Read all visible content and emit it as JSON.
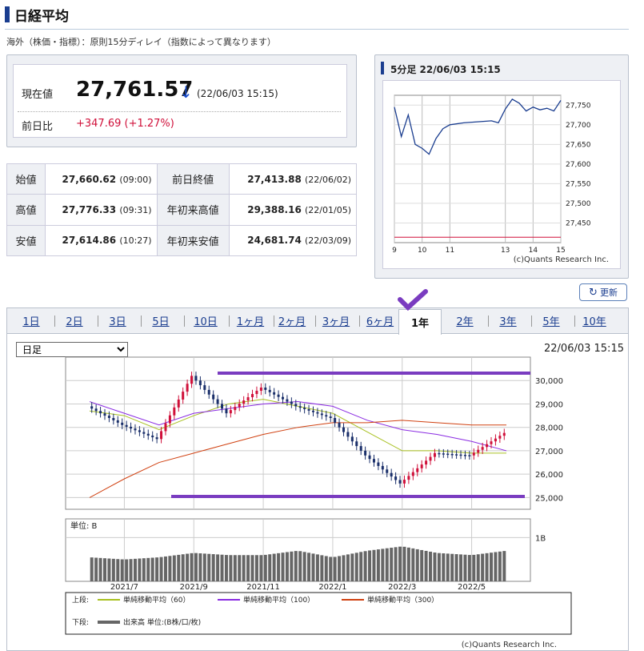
{
  "header": {
    "title": "日経平均",
    "note": "海外（株価・指標）：原則15分ディレイ（指数によって異なります）"
  },
  "quote": {
    "price_label": "現在値",
    "price": "27,761.57",
    "arrow": "↓",
    "time": "(22/06/03 15:15)",
    "change_label": "前日比",
    "change": "+347.69 (+1.27%)"
  },
  "ohlc": [
    {
      "l1": "始値",
      "v1": "27,660.62",
      "t1": "(09:00)",
      "l2": "前日終値",
      "v2": "27,413.88",
      "t2": "(22/06/02)"
    },
    {
      "l1": "高値",
      "v1": "27,776.33",
      "t1": "(09:31)",
      "l2": "年初来高値",
      "v2": "29,388.16",
      "t2": "(22/01/05)"
    },
    {
      "l1": "安値",
      "v1": "27,614.86",
      "t1": "(10:27)",
      "l2": "年初来安値",
      "v2": "24,681.74",
      "t2": "(22/03/09)"
    }
  ],
  "mini": {
    "title": "5分足 22/06/03 15:15",
    "credit": "(c)Quants Research Inc.",
    "refresh": "更新"
  },
  "tabs": [
    "1日",
    "2日",
    "3日",
    "5日",
    "10日",
    "1ヶ月",
    "2ヶ月",
    "3ヶ月",
    "6ヶ月",
    "1年",
    "2年",
    "3年",
    "5年",
    "10年"
  ],
  "active_tab": "1年",
  "select_value": "日足",
  "chart_time": "22/06/03 15:15",
  "colors": {
    "accent": "#1a3d8f",
    "up": "#d0103a",
    "down": "#1a2f6a",
    "ma60": "#a8c020",
    "ma100": "#8a2be2",
    "ma300": "#d04010",
    "annot": "#7a3cc0"
  },
  "chart_data": [
    {
      "type": "line",
      "title": "5分足",
      "x": [
        9,
        9.25,
        9.5,
        9.75,
        10,
        10.25,
        10.5,
        10.75,
        11,
        11.5,
        12.5,
        12.75,
        13,
        13.25,
        13.5,
        13.75,
        14,
        14.25,
        14.5,
        14.75,
        15
      ],
      "values": [
        27745,
        27670,
        27725,
        27650,
        27640,
        27625,
        27665,
        27690,
        27700,
        27705,
        27710,
        27705,
        27740,
        27765,
        27755,
        27735,
        27745,
        27738,
        27742,
        27735,
        27762
      ],
      "xticks": [
        "9",
        "10",
        "11",
        "13",
        "14",
        "15"
      ],
      "yticks": [
        "27,750",
        "27,700",
        "27,650",
        "27,600",
        "27,550",
        "27,500",
        "27,450"
      ],
      "ylim": [
        27400,
        27775
      ],
      "prev_close": 27413.88
    },
    {
      "type": "line",
      "title": "1年 日足",
      "x": [
        "2021/6",
        "2021/7",
        "2021/8",
        "2021/9",
        "2021/10",
        "2021/11",
        "2021/12",
        "2022/1",
        "2022/2",
        "2022/3",
        "2022/4",
        "2022/5",
        "2022/6"
      ],
      "values": [
        28900,
        28100,
        27500,
        30200,
        28600,
        29700,
        28900,
        28400,
        26800,
        25600,
        26900,
        26800,
        27761
      ],
      "series": [
        {
          "name": "単純移動平均（60）",
          "values": [
            28700,
            28500,
            27900,
            28500,
            29000,
            29200,
            28900,
            28600,
            27800,
            27000,
            27000,
            26900,
            26900
          ]
        },
        {
          "name": "単純移動平均（100）",
          "values": [
            29100,
            28600,
            28100,
            28600,
            28800,
            29000,
            29100,
            28900,
            28300,
            27900,
            27700,
            27400,
            27000
          ]
        },
        {
          "name": "単純移動平均（300）",
          "values": [
            25000,
            25800,
            26500,
            26900,
            27300,
            27700,
            28000,
            28200,
            28200,
            28300,
            28200,
            28100,
            28100
          ]
        }
      ],
      "volume": [
        0.55,
        0.5,
        0.55,
        0.65,
        0.6,
        0.6,
        0.7,
        0.55,
        0.7,
        0.8,
        0.65,
        0.6,
        0.7
      ],
      "xticks": [
        "2021/7",
        "2021/9",
        "2021/11",
        "2022/1",
        "2022/3",
        "2022/5"
      ],
      "yticks": [
        "30,000",
        "29,000",
        "28,000",
        "27,000",
        "26,000",
        "25,000"
      ],
      "ylim": [
        24500,
        31000
      ],
      "vol_unit": "単位: B",
      "vol_tick": "1B",
      "legend": {
        "upper": "上段:",
        "lower": "下段:",
        "ma60": "単純移動平均（60）",
        "ma100": "単純移動平均（100）",
        "ma300": "単純移動平均（300）",
        "volume": "出来高 単位:(B株/口/枚)"
      },
      "credit": "(c)Quants Research Inc."
    }
  ]
}
